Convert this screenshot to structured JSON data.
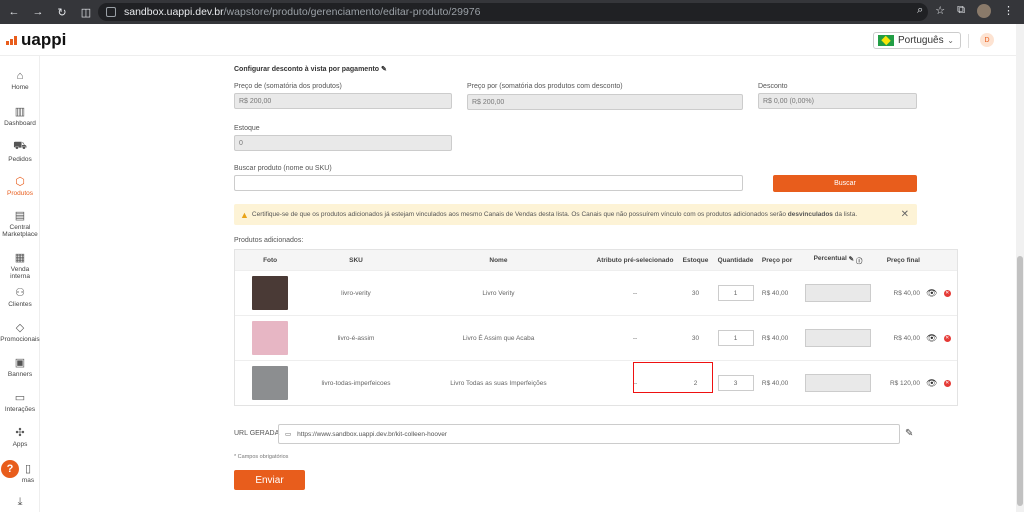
{
  "browser": {
    "url_host": "sandbox.uappi.dev.br",
    "url_path": "/wapstore/produto/gerenciamento/editar-produto/29976"
  },
  "header": {
    "logo": "uappi",
    "language": "Português",
    "avatar_initial": "D"
  },
  "sidebar": {
    "items": [
      {
        "label": "Home",
        "icon": "home-icon"
      },
      {
        "label": "Dashboard",
        "icon": "dashboard-icon"
      },
      {
        "label": "Pedidos",
        "icon": "cart-icon"
      },
      {
        "label": "Produtos",
        "icon": "box-icon",
        "active": true
      },
      {
        "label": "Central Marketplace",
        "icon": "marketplace-icon"
      },
      {
        "label": "Venda interna",
        "icon": "store-icon"
      },
      {
        "label": "Clientes",
        "icon": "users-icon"
      },
      {
        "label": "Promocionais",
        "icon": "tag-icon"
      },
      {
        "label": "Banners",
        "icon": "image-icon"
      },
      {
        "label": "Interações",
        "icon": "chat-icon"
      },
      {
        "label": "Apps",
        "icon": "puzzle-icon"
      },
      {
        "label": "mas",
        "icon": "doc-icon"
      }
    ],
    "help_label": "?"
  },
  "form": {
    "discount_title": "Configurar desconto à vista por pagamento",
    "preco_de_label": "Preço de (somatória dos produtos)",
    "preco_de_value": "R$ 200,00",
    "preco_por_label": "Preço por (somatória dos produtos com desconto)",
    "preco_por_value": "R$ 200,00",
    "desconto_label": "Desconto",
    "desconto_value": "R$ 0,00 (0,00%)",
    "estoque_label": "Estoque",
    "estoque_value": "0",
    "buscar_label": "Buscar produto (nome ou SKU)",
    "buscar_value": "",
    "buscar_button": "Buscar"
  },
  "warning": {
    "text_before": "Certifique-se de que os produtos adicionados já estejam vinculados aos mesmo Canais de Vendas desta lista. Os Canais que não possuírem vínculo com os produtos adicionados serão ",
    "text_bold": "desvinculados",
    "text_after": " da lista."
  },
  "table": {
    "title": "Produtos adicionados:",
    "headers": {
      "foto": "Foto",
      "sku": "SKU",
      "nome": "Nome",
      "atributo": "Atributo pré-selecionado",
      "estoque": "Estoque",
      "quantidade": "Quantidade",
      "preco_por": "Preço por",
      "percentual": "Percentual",
      "preco_final": "Preço final"
    },
    "rows": [
      {
        "sku": "livro-verity",
        "nome": "Livro Verity",
        "atributo": "--",
        "estoque": "30",
        "quantidade": "1",
        "preco_por": "R$ 40,00",
        "preco_final": "R$ 40,00",
        "thumb_color": "#4a3a36"
      },
      {
        "sku": "livro-é-assim",
        "nome": "Livro É Assim que Acaba",
        "atributo": "--",
        "estoque": "30",
        "quantidade": "1",
        "preco_por": "R$ 40,00",
        "preco_final": "R$ 40,00",
        "thumb_color": "#e7b6c4"
      },
      {
        "sku": "livro-todas-imperfeicoes",
        "nome": "Livro Todas as suas Imperfeições",
        "atributo": "--",
        "estoque": "2",
        "quantidade": "3",
        "preco_por": "R$ 40,00",
        "preco_final": "R$ 120,00",
        "thumb_color": "#8c8e90"
      }
    ]
  },
  "url": {
    "label": "URL GERADA",
    "value": "https://www.sandbox.uappi.dev.br/kit-colleen-hoover"
  },
  "footer": {
    "required_note": "* Campos obrigatórios",
    "submit": "Enviar"
  },
  "colors": {
    "accent": "#e85d1c",
    "highlight": "#e11111"
  }
}
